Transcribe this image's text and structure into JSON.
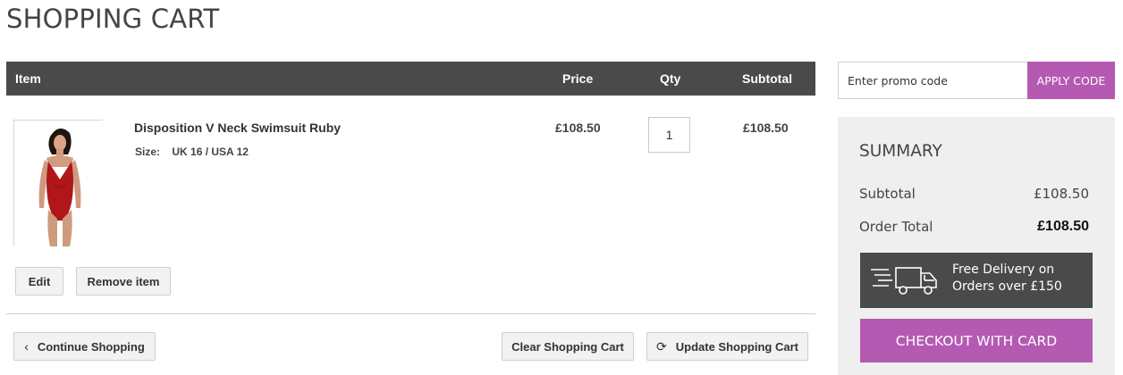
{
  "page_title": "SHOPPING CART",
  "table": {
    "headers": {
      "item": "Item",
      "price": "Price",
      "qty": "Qty",
      "subtotal": "Subtotal"
    },
    "items": [
      {
        "name": "Disposition V Neck Swimsuit Ruby",
        "option_label": "Size:",
        "option_value": "UK 16 / USA 12",
        "price": "£108.50",
        "qty": "1",
        "subtotal": "£108.50",
        "image_icon": "red-swimsuit-product-photo"
      }
    ]
  },
  "item_actions": {
    "edit": "Edit",
    "remove": "Remove item"
  },
  "cart_actions": {
    "continue": "Continue Shopping",
    "clear": "Clear Shopping Cart",
    "update": "Update Shopping Cart"
  },
  "promo": {
    "placeholder": "Enter promo code",
    "apply": "APPLY CODE"
  },
  "summary": {
    "title": "SUMMARY",
    "subtotal_label": "Subtotal",
    "subtotal_value": "£108.50",
    "total_label": "Order Total",
    "total_value": "£108.50",
    "delivery_line1": "Free Delivery on",
    "delivery_line2": "Orders over £150",
    "checkout": "CHECKOUT WITH CARD"
  },
  "colors": {
    "accent": "#b45ab2",
    "header_bg": "#4a4a4a",
    "summary_bg": "#efefef"
  }
}
